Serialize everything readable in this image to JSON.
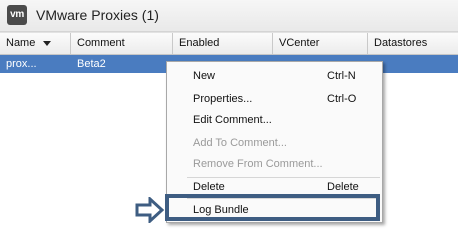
{
  "window": {
    "title": "VMware Proxies (1)",
    "logo_text": "vm"
  },
  "table": {
    "columns": [
      {
        "label": "Name",
        "sort": "descending"
      },
      {
        "label": "Comment"
      },
      {
        "label": "Enabled"
      },
      {
        "label": "VCenter"
      },
      {
        "label": "Datastores"
      }
    ],
    "rows": [
      {
        "name": "prox...",
        "comment": "Beta2",
        "selected": true
      }
    ]
  },
  "context_menu": {
    "items": [
      {
        "label": "New",
        "shortcut": "Ctrl-N",
        "enabled": true
      },
      {
        "label": "Properties...",
        "shortcut": "Ctrl-O",
        "enabled": true
      },
      {
        "label": "Edit Comment...",
        "shortcut": "",
        "enabled": true
      },
      {
        "label": "Add To Comment...",
        "shortcut": "",
        "enabled": false
      },
      {
        "label": "Remove From Comment...",
        "shortcut": "",
        "enabled": false
      },
      {
        "label": "Delete",
        "shortcut": "Delete",
        "enabled": true
      },
      {
        "label": "Log Bundle",
        "shortcut": "",
        "enabled": true,
        "highlighted": true
      }
    ]
  },
  "colors": {
    "selection": "#4a7cc0",
    "highlight_box": "#3e5d82",
    "disabled_text": "#9a9a9a"
  },
  "icons": [
    "vmware-logo-icon",
    "sort-descending-icon",
    "pointer-arrow-icon"
  ]
}
